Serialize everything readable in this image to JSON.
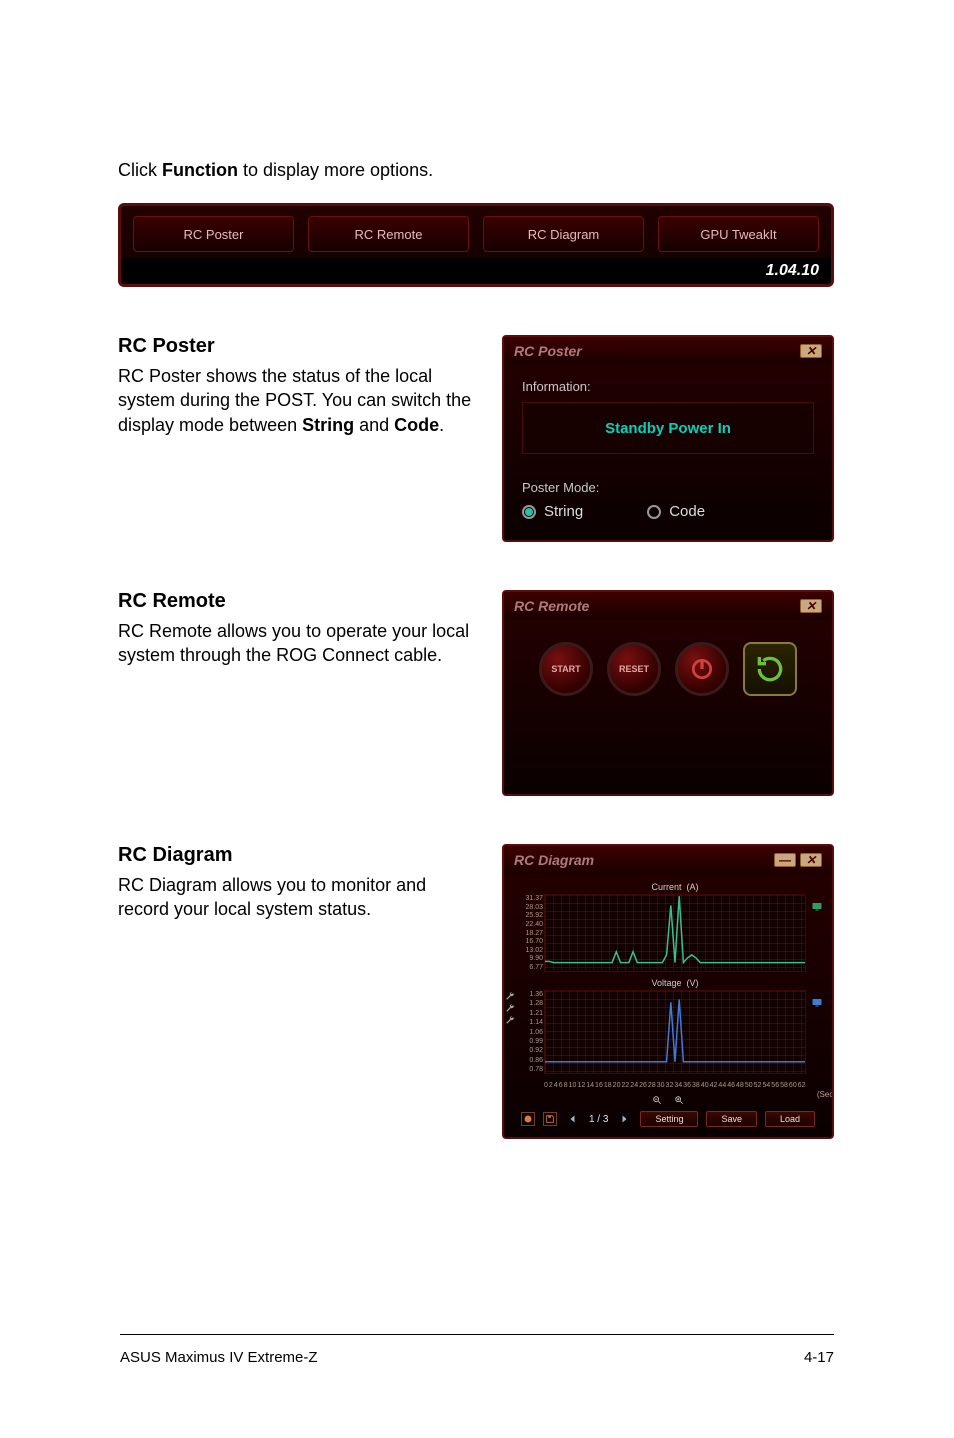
{
  "intro": {
    "pre": "Click ",
    "bold": "Function",
    "post": " to display more options."
  },
  "tabs": {
    "items": [
      "RC Poster",
      "RC Remote",
      "RC Diagram",
      "GPU TweakIt"
    ],
    "version": "1.04.10"
  },
  "poster": {
    "heading": "RC Poster",
    "desc_pre": "RC Poster shows the status of the local system during the POST. You can switch the display mode between ",
    "desc_b1": "String",
    "desc_mid": " and ",
    "desc_b2": "Code",
    "desc_post": ".",
    "panel_title": "RC Poster",
    "info_label": "Information:",
    "info_value": "Standby Power In",
    "mode_label": "Poster Mode:",
    "opt_string": "String",
    "opt_code": "Code"
  },
  "remote": {
    "heading": "RC Remote",
    "desc": "RC Remote allows you to operate your local system through the ROG Connect cable.",
    "panel_title": "RC Remote",
    "btn_start": "START",
    "btn_reset": "RESET"
  },
  "diagram": {
    "heading": "RC Diagram",
    "desc": "RC Diagram allows you to monitor and record your local system status.",
    "panel_title": "RC Diagram",
    "page": "1 / 3",
    "btn_setting": "Setting",
    "btn_save": "Save",
    "btn_load": "Load",
    "sec_unit": "(Sec)"
  },
  "chart_data": [
    {
      "type": "line",
      "title": "Current",
      "unit": "(A)",
      "y_ticks": [
        "31.37",
        "28.03",
        "25.92",
        "22.40",
        "18.27",
        "16.70",
        "13.02",
        "9.90",
        "6.77"
      ],
      "ylim": [
        6.77,
        31.37
      ],
      "x_ticks": [
        "0",
        "2",
        "4",
        "6",
        "8",
        "10",
        "12",
        "14",
        "16",
        "18",
        "20",
        "22",
        "24",
        "26",
        "28",
        "30",
        "32",
        "34",
        "36",
        "38",
        "40",
        "42",
        "44",
        "46",
        "48",
        "50",
        "52",
        "54",
        "56",
        "58",
        "60",
        "62"
      ],
      "series": [
        {
          "name": "Current(A)",
          "color": "#35c28a",
          "y": [
            9.9,
            9.9,
            9.5,
            9.5,
            9.5,
            9.5,
            9.5,
            9.5,
            9.5,
            9.5,
            9.5,
            9.5,
            9.5,
            9.5,
            9.5,
            9.5,
            9.5,
            13.0,
            9.5,
            9.5,
            9.5,
            13.0,
            9.5,
            9.5,
            9.5,
            9.5,
            9.5,
            9.5,
            9.5,
            12.0,
            28.0,
            9.5,
            31.0,
            9.5,
            11.0,
            12.0,
            11.0,
            9.5,
            9.5,
            9.5,
            9.5,
            9.5,
            9.5,
            9.5,
            9.5,
            9.5,
            9.5,
            9.5,
            9.5,
            9.5,
            9.5,
            9.5,
            9.5,
            9.5,
            9.5,
            9.5,
            9.5,
            9.5,
            9.5,
            9.5,
            9.5,
            9.5,
            9.5
          ]
        }
      ]
    },
    {
      "type": "line",
      "title": "Voltage",
      "unit": "(V)",
      "y_ticks": [
        "1.36",
        "1.28",
        "1.21",
        "1.14",
        "1.06",
        "0.99",
        "0.92",
        "0.86",
        "0.78"
      ],
      "ylim": [
        0.78,
        1.36
      ],
      "x_ticks": [
        "0",
        "2",
        "4",
        "6",
        "8",
        "10",
        "12",
        "14",
        "16",
        "18",
        "20",
        "22",
        "24",
        "26",
        "28",
        "30",
        "32",
        "34",
        "36",
        "38",
        "40",
        "42",
        "44",
        "46",
        "48",
        "50",
        "52",
        "54",
        "56",
        "58",
        "60",
        "62"
      ],
      "series": [
        {
          "name": "Voltage(V)",
          "color": "#3d7bd6",
          "y": [
            0.86,
            0.86,
            0.86,
            0.86,
            0.86,
            0.86,
            0.86,
            0.86,
            0.86,
            0.86,
            0.86,
            0.86,
            0.86,
            0.86,
            0.86,
            0.86,
            0.86,
            0.86,
            0.86,
            0.86,
            0.86,
            0.86,
            0.86,
            0.86,
            0.86,
            0.86,
            0.86,
            0.86,
            0.86,
            0.86,
            1.28,
            0.86,
            1.3,
            0.86,
            0.86,
            0.86,
            0.86,
            0.86,
            0.86,
            0.86,
            0.86,
            0.86,
            0.86,
            0.86,
            0.86,
            0.86,
            0.86,
            0.86,
            0.86,
            0.86,
            0.86,
            0.86,
            0.86,
            0.86,
            0.86,
            0.86,
            0.86,
            0.86,
            0.86,
            0.86,
            0.86,
            0.86,
            0.86
          ]
        }
      ]
    }
  ],
  "footer": {
    "left": "ASUS Maximus IV Extreme-Z",
    "right": "4-17"
  }
}
